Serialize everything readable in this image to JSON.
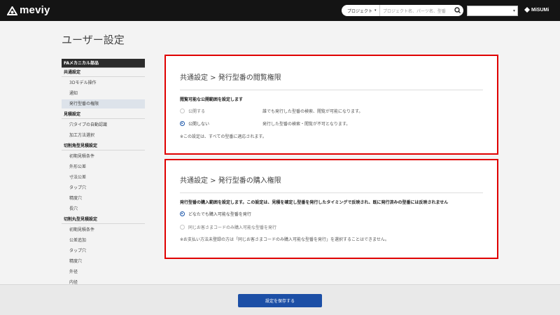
{
  "header": {
    "logo_text": "meviy",
    "search_scope": "プロジェクト",
    "search_placeholder": "プロジェクト名、パーツ名、型番",
    "brand": "MiSUMi",
    "colors": {
      "bar": "#141414",
      "accent": "#1c4fa6",
      "highlight": "#e00000"
    }
  },
  "page": {
    "title": "ユーザー設定"
  },
  "sidebar": {
    "header": "FAメカニカル部品",
    "sections": [
      {
        "label": "共通設定",
        "items": [
          "3Dモデル操作",
          "通知",
          "発行型番の権限"
        ]
      },
      {
        "label": "見積設定",
        "items": [
          "穴タイプの自動認識",
          "加工方法選択"
        ]
      },
      {
        "label": "切削角型見積設定",
        "items": [
          "初期見積条件",
          "外形公差",
          "寸法公差",
          "タップ穴",
          "精度穴",
          "長穴"
        ]
      },
      {
        "label": "切削丸型見積設定",
        "items": [
          "初期見積条件",
          "公差追加",
          "タップ穴",
          "精度穴",
          "外径",
          "内径"
        ]
      }
    ],
    "active_item": "発行型番の権限"
  },
  "panel_view": {
    "title": "共通設定 > 発行型番の閲覧権限",
    "description": "閲覧可能な公開範囲を設定します",
    "options": [
      {
        "label": "公開する",
        "desc": "誰でも発行した型番の検索、閲覧が可能になります。",
        "selected": false
      },
      {
        "label": "公開しない",
        "desc": "発行した型番の検索・閲覧が不可となります。",
        "selected": true
      }
    ],
    "note": "※この設定は、すべての型番に適応されます。"
  },
  "panel_purchase": {
    "title": "共通設定 > 発行型番の購入権限",
    "description": "発行型番の購入範囲を設定します。この設定は、見積を確定し型番を発行したタイミングで反映され、既に発行済みの型番には反映されません",
    "options": [
      {
        "label": "どなたでも購入可能な型番を発行",
        "selected": true
      },
      {
        "label": "同じお客さまコードのみ購入可能な型番を発行",
        "selected": false
      }
    ],
    "note": "※お支払い方法未登録の方は「同じお客さまコードのみ購入可能な型番を発行」を選択することはできません。"
  },
  "footer": {
    "save_label": "設定を保存する"
  }
}
